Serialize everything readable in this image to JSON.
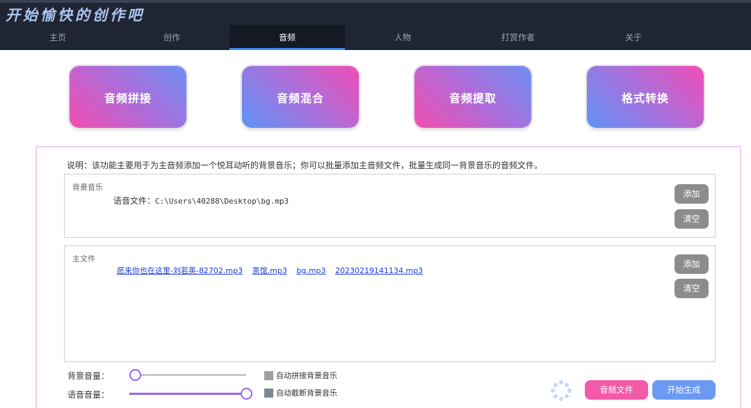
{
  "app": {
    "title": "开始愉快的创作吧"
  },
  "nav": {
    "tabs": [
      {
        "label": "主页",
        "active": false
      },
      {
        "label": "创作",
        "active": false
      },
      {
        "label": "音频",
        "active": true
      },
      {
        "label": "人物",
        "active": false
      },
      {
        "label": "打赏作者",
        "active": false
      },
      {
        "label": "关于",
        "active": false
      }
    ]
  },
  "features": [
    {
      "label": "音频拼接"
    },
    {
      "label": "音频混合"
    },
    {
      "label": "音频提取"
    },
    {
      "label": "格式转换"
    }
  ],
  "description": "说明：该功能主要用于为主音频添加一个悦耳动听的背景音乐；你可以批量添加主音频文件，批量生成同一背景音乐的音频文件。",
  "background_music": {
    "label": "背景音乐",
    "file_prefix": "语音文件：",
    "file_path": "C:\\Users\\40288\\Desktop\\bg.mp3",
    "add_label": "添加",
    "clear_label": "清空"
  },
  "main_files": {
    "label": "主文件",
    "files": [
      "愿来你也在这里-刘若英-82702.mp3",
      "茶馆.mp3",
      "bg.mp3",
      "20230219141134.mp3"
    ],
    "add_label": "添加",
    "clear_label": "清空"
  },
  "volume": {
    "bg_label": "背景音量：",
    "bg_level": 0.05,
    "voice_label": "语音音量：",
    "voice_level": 1.0
  },
  "options": {
    "auto_concat_label": "自动拼接背景音乐",
    "auto_truncate_label": "自动截断背景音乐"
  },
  "actions": {
    "audio_file_label": "音频文件",
    "generate_label": "开始生成"
  },
  "colors": {
    "header_bg": "#1f2532",
    "active_tab_accent": "#3d8bf0",
    "pink": "#f04db6",
    "blue": "#5d93f5",
    "slider": "#9b64e6",
    "link": "#1a3ad8"
  }
}
